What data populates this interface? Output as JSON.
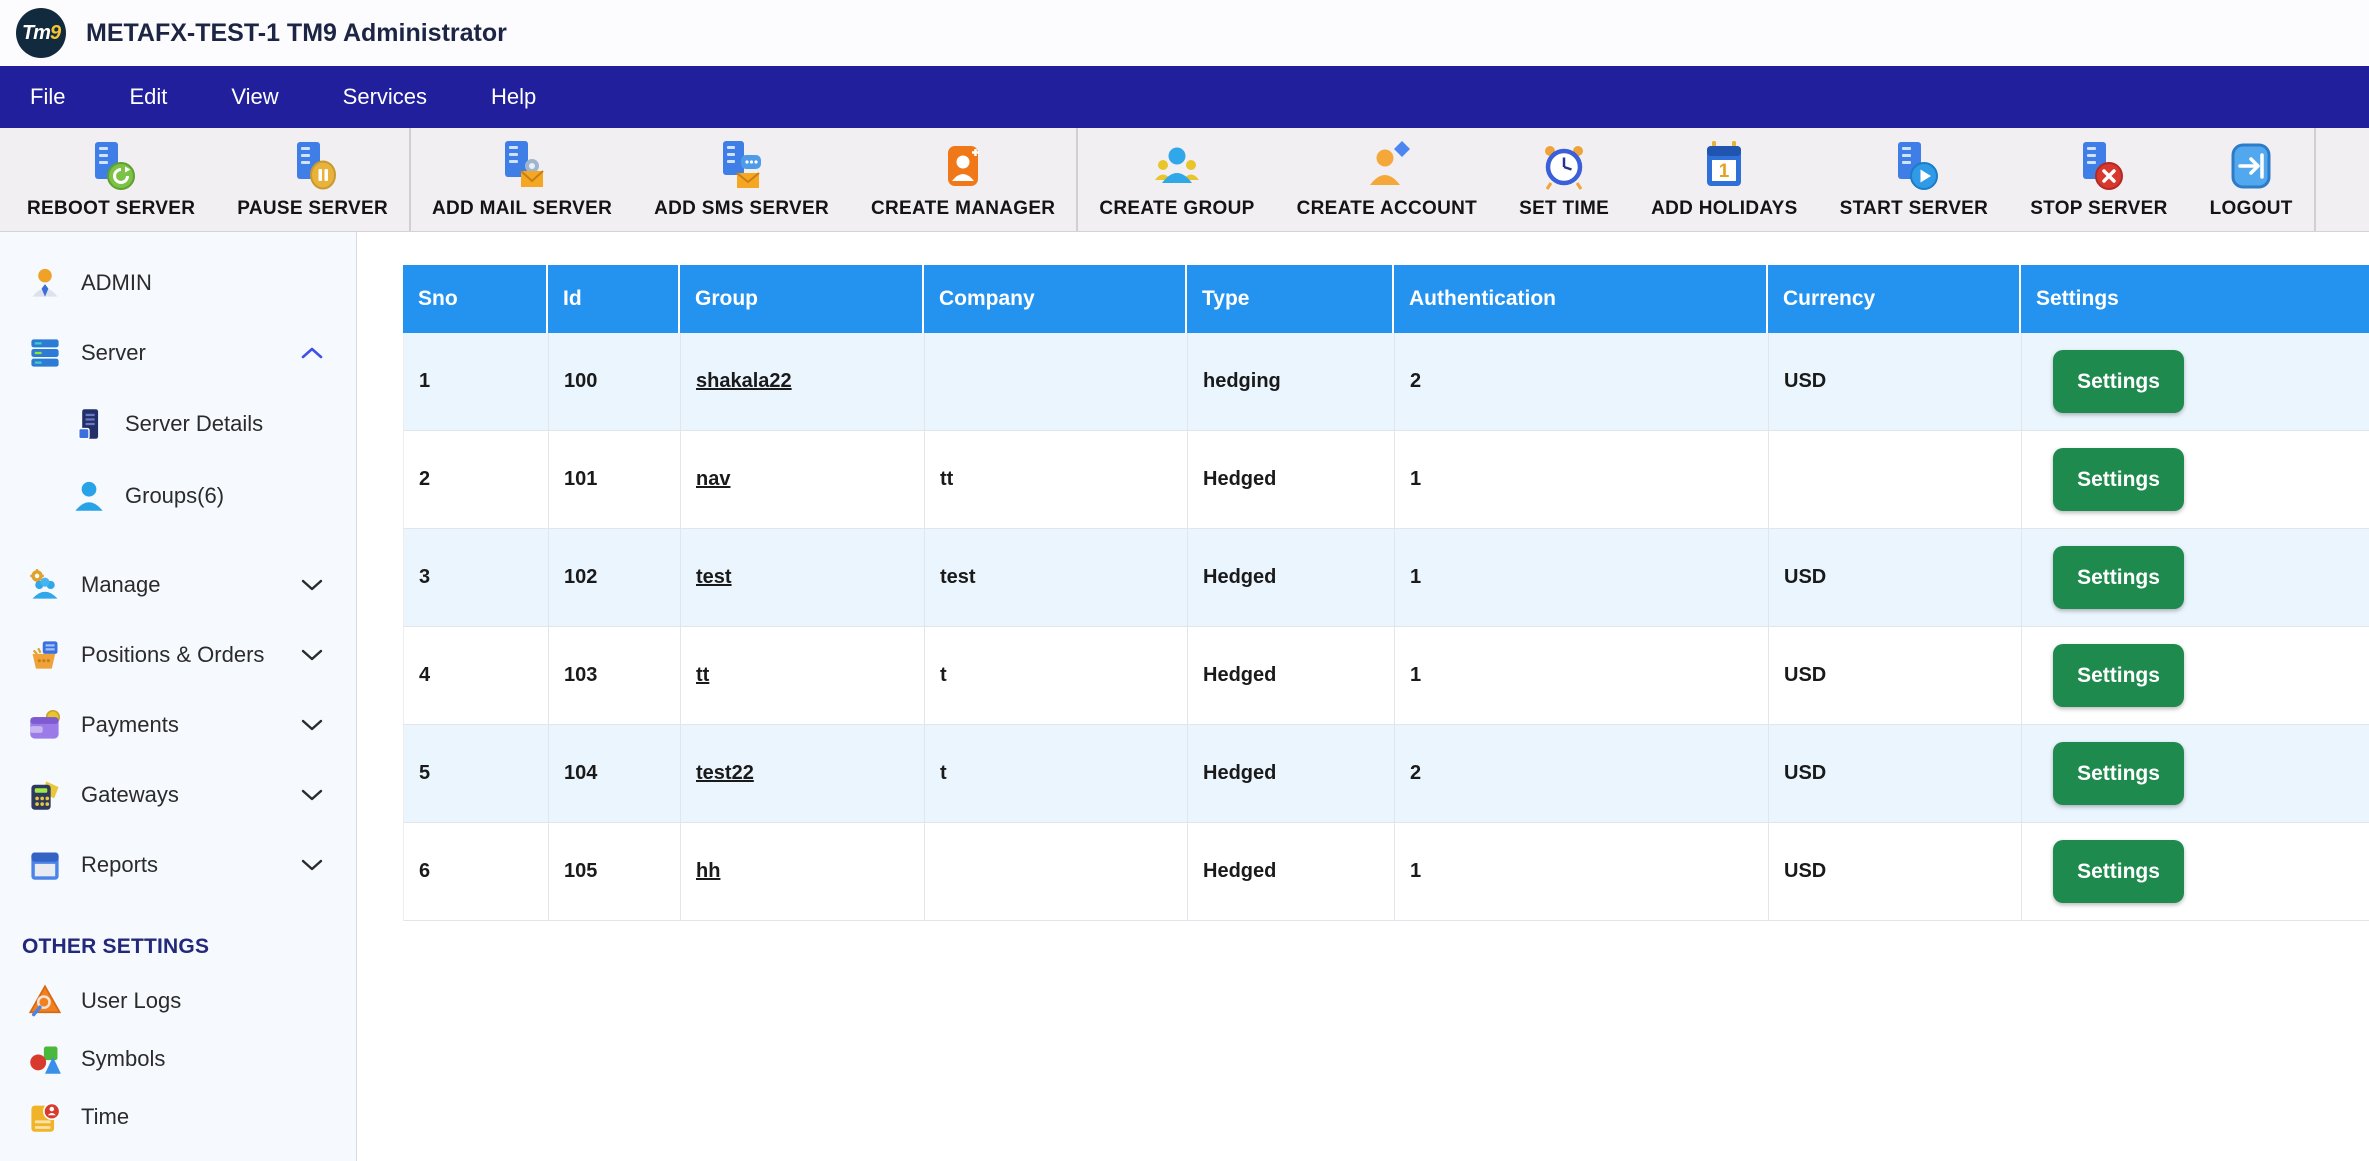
{
  "app": {
    "title": "METAFX-TEST-1 TM9 Administrator",
    "logo_tm": "Tm",
    "logo_9": "9"
  },
  "colors": {
    "menu_navy": "#211F9C",
    "table_header_blue": "#2493F0",
    "settings_green": "#1F8A4E",
    "alt_row_blue": "#EBF5FE"
  },
  "menu": {
    "items": [
      "File",
      "Edit",
      "View",
      "Services",
      "Help"
    ]
  },
  "toolbar": {
    "buttons": [
      {
        "label": "REBOOT SERVER"
      },
      {
        "label": "PAUSE SERVER"
      },
      {
        "label": "ADD MAIL SERVER"
      },
      {
        "label": "ADD SMS SERVER"
      },
      {
        "label": "CREATE MANAGER"
      },
      {
        "label": "CREATE GROUP"
      },
      {
        "label": "CREATE ACCOUNT"
      },
      {
        "label": "SET TIME"
      },
      {
        "label": "ADD HOLIDAYS"
      },
      {
        "label": "START SERVER"
      },
      {
        "label": "STOP SERVER"
      },
      {
        "label": "LOGOUT"
      }
    ]
  },
  "sidebar": {
    "items": [
      {
        "label": "ADMIN"
      },
      {
        "label": "Server"
      },
      {
        "label": "Server Details"
      },
      {
        "label": "Groups(6)"
      },
      {
        "label": "Manage"
      },
      {
        "label": "Positions & Orders"
      },
      {
        "label": "Payments"
      },
      {
        "label": "Gateways"
      },
      {
        "label": "Reports"
      }
    ],
    "section_header": "OTHER SETTINGS",
    "other_items": [
      {
        "label": "User Logs"
      },
      {
        "label": "Symbols"
      },
      {
        "label": "Time"
      }
    ]
  },
  "table": {
    "columns": [
      "Sno",
      "Id",
      "Group",
      "Company",
      "Type",
      "Authentication",
      "Currency",
      "Settings"
    ],
    "settings_button_label": "Settings",
    "rows": [
      {
        "sno": "1",
        "id": "100",
        "group": "shakala22",
        "company": "",
        "type": "hedging",
        "authentication": "2",
        "currency": "USD"
      },
      {
        "sno": "2",
        "id": "101",
        "group": "nav",
        "company": "tt",
        "type": "Hedged",
        "authentication": "1",
        "currency": ""
      },
      {
        "sno": "3",
        "id": "102",
        "group": "test",
        "company": "test",
        "type": "Hedged",
        "authentication": "1",
        "currency": "USD"
      },
      {
        "sno": "4",
        "id": "103",
        "group": "tt",
        "company": "t",
        "type": "Hedged",
        "authentication": "1",
        "currency": "USD"
      },
      {
        "sno": "5",
        "id": "104",
        "group": "test22",
        "company": "t",
        "type": "Hedged",
        "authentication": "2",
        "currency": "USD"
      },
      {
        "sno": "6",
        "id": "105",
        "group": "hh",
        "company": "",
        "type": "Hedged",
        "authentication": "1",
        "currency": "USD"
      }
    ]
  }
}
